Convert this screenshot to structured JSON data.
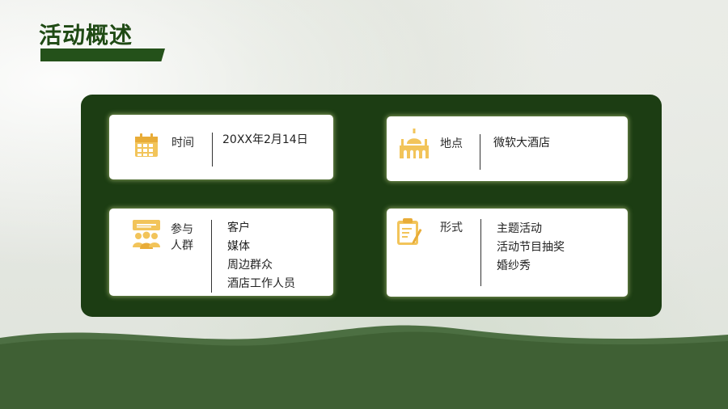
{
  "slide": {
    "title": "活动概述"
  },
  "cards": {
    "time": {
      "label": "时间",
      "value": "20XX年2月14日",
      "icon": "calendar-icon"
    },
    "place": {
      "label": "地点",
      "value": "微软大酒店",
      "icon": "building-icon"
    },
    "people": {
      "label_line1": "参与",
      "label_line2": "人群",
      "items": [
        "客户",
        "媒体",
        "周边群众",
        "酒店工作人员"
      ],
      "icon": "audience-icon"
    },
    "form": {
      "label": "形式",
      "items": [
        "主题活动",
        "活动节目抽奖",
        "婚纱秀"
      ],
      "icon": "clipboard-icon"
    }
  },
  "colors": {
    "accent_green": "#1c3d13",
    "title_green": "#1f4a14",
    "icon_gold": "#f2c45a"
  }
}
